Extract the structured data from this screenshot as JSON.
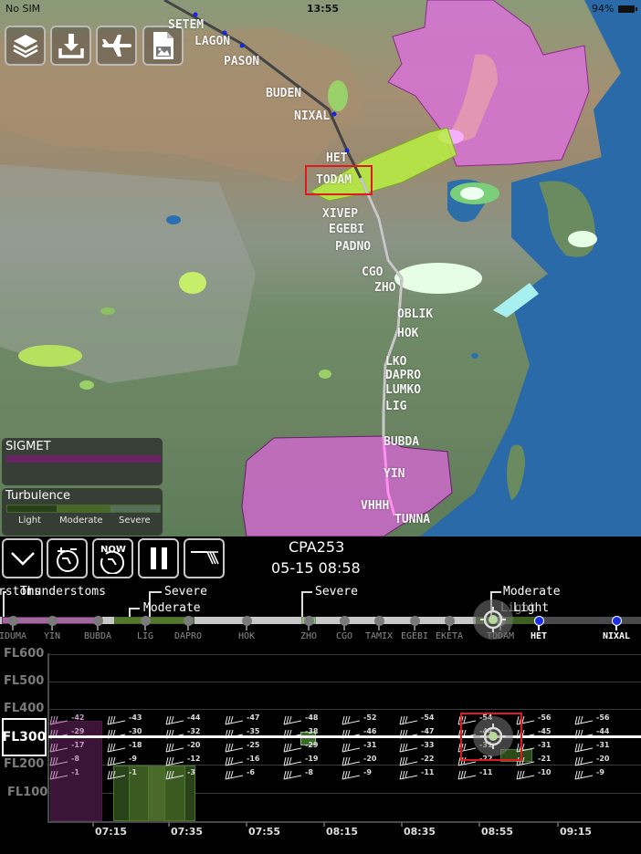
{
  "status_bar": {
    "carrier": "No SIM",
    "time": "13:55",
    "battery": "94%"
  },
  "toolbar": {
    "buttons": [
      {
        "name": "layers",
        "icon": "layers-icon"
      },
      {
        "name": "download",
        "icon": "download-icon"
      },
      {
        "name": "flights",
        "icon": "airplane-icon"
      },
      {
        "name": "export-image",
        "icon": "image-file-icon"
      }
    ]
  },
  "map": {
    "waypoints": [
      {
        "id": "SETEM",
        "label": "SETEM"
      },
      {
        "id": "LAGON",
        "label": "LAGON"
      },
      {
        "id": "PASON",
        "label": "PASON"
      },
      {
        "id": "BUDEN",
        "label": "BUDEN"
      },
      {
        "id": "NIXAL",
        "label": "NIXAL"
      },
      {
        "id": "HET",
        "label": "HET"
      },
      {
        "id": "TODAM",
        "label": "TODAM"
      },
      {
        "id": "XIVEP",
        "label": "XIVEP"
      },
      {
        "id": "EGEBI",
        "label": "EGEBI"
      },
      {
        "id": "PADNO",
        "label": "PADNO"
      },
      {
        "id": "CGO",
        "label": "CGO"
      },
      {
        "id": "ZHO",
        "label": "ZHO"
      },
      {
        "id": "OBLIK",
        "label": "OBLIK"
      },
      {
        "id": "HOK",
        "label": "HOK"
      },
      {
        "id": "LKO",
        "label": "LKO"
      },
      {
        "id": "DAPRO",
        "label": "DAPRO"
      },
      {
        "id": "LUMKO",
        "label": "LUMKO"
      },
      {
        "id": "LIG",
        "label": "LIG"
      },
      {
        "id": "BUBDA",
        "label": "BUBDA"
      },
      {
        "id": "YIN",
        "label": "YIN"
      },
      {
        "id": "VHHH",
        "label": "VHHH"
      },
      {
        "id": "TUNNA",
        "label": "TUNNA"
      }
    ],
    "selected_waypoint": "TODAM"
  },
  "legend": {
    "sigmet": {
      "title": "SIGMET",
      "color": "#6a2466"
    },
    "turbulence": {
      "title": "Turbulence",
      "levels": [
        {
          "label": "Light",
          "color": "#26401a"
        },
        {
          "label": "Moderate",
          "color": "#46692a"
        },
        {
          "label": "Severe",
          "color": "#55705a"
        }
      ]
    }
  },
  "controls": {
    "buttons": [
      {
        "name": "collapse",
        "icon": "chevron-down-icon"
      },
      {
        "name": "time-offset",
        "icon": "timer-plus-minus-icon"
      },
      {
        "name": "now",
        "label": "NOW",
        "icon": "clock-now-icon"
      },
      {
        "name": "pause",
        "icon": "pause-icon"
      },
      {
        "name": "wind-barbs",
        "icon": "wind-barb-icon"
      }
    ],
    "flight_id": "CPA253",
    "flight_time": "05-15 08:58"
  },
  "route_strip": {
    "hazard_labels": [
      {
        "text": "rstoms"
      },
      {
        "text": "Thunderstoms"
      },
      {
        "text": "Severe"
      },
      {
        "text": "Moderate"
      },
      {
        "text": "Severe"
      },
      {
        "text": "Moderate"
      },
      {
        "text": "Light"
      },
      {
        "text": "Light"
      }
    ],
    "waypoints": [
      {
        "label": "IDUMA",
        "active": false
      },
      {
        "label": "YIN",
        "active": false
      },
      {
        "label": "BUBDA",
        "active": false
      },
      {
        "label": "LIG",
        "active": false
      },
      {
        "label": "DAPRO",
        "active": false
      },
      {
        "label": "HOK",
        "active": false
      },
      {
        "label": "ZHO",
        "active": false
      },
      {
        "label": "CGO",
        "active": false
      },
      {
        "label": "TAMIX",
        "active": false
      },
      {
        "label": "EGEBI",
        "active": false
      },
      {
        "label": "EKETA",
        "active": false
      },
      {
        "label": "TODAM",
        "active": false
      },
      {
        "label": "HET",
        "active": true
      },
      {
        "label": "NIXAL",
        "active": true
      }
    ]
  },
  "profile": {
    "flight_levels": [
      "FL600",
      "FL500",
      "FL400",
      "FL300",
      "FL200",
      "FL100"
    ],
    "current_level": "FL300",
    "time_labels": [
      "07:15",
      "07:35",
      "07:55",
      "08:15",
      "08:35",
      "08:55",
      "09:15"
    ],
    "temperature_columns": [
      [
        "-42",
        "-29",
        "-17",
        "-8",
        "-1"
      ],
      [
        "-43",
        "-30",
        "-18",
        "-9",
        "-1"
      ],
      [
        "-44",
        "-32",
        "-20",
        "-12",
        "-3"
      ],
      [
        "-47",
        "-35",
        "-25",
        "-16",
        "-6"
      ],
      [
        "-48",
        "-38",
        "-29",
        "-19",
        "-8"
      ],
      [
        "-52",
        "-46",
        "-31",
        "-20",
        "-9"
      ],
      [
        "-54",
        "-47",
        "-33",
        "-22",
        "-11"
      ],
      [
        "-54",
        "-44",
        "-31",
        "-22",
        "-11"
      ],
      [
        "-56",
        "-45",
        "-31",
        "-21",
        "-10"
      ],
      [
        "-56",
        "-44",
        "-31",
        "-20",
        "-9"
      ]
    ]
  }
}
